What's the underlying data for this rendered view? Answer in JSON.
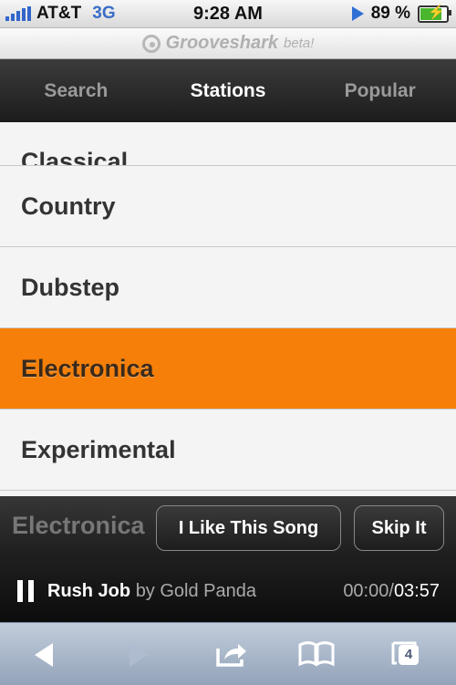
{
  "status_bar": {
    "carrier": "AT&T",
    "network": "3G",
    "time": "9:28 AM",
    "battery_percent": "89 %",
    "battery_level": 0.89
  },
  "browser": {
    "site_name": "Grooveshark",
    "site_tag": "beta!",
    "open_tabs": "4"
  },
  "nav": {
    "tabs": [
      {
        "label": "Search"
      },
      {
        "label": "Stations"
      },
      {
        "label": "Popular"
      }
    ],
    "active_tab": "Stations"
  },
  "stations": {
    "items": [
      {
        "label": "Classical"
      },
      {
        "label": "Country"
      },
      {
        "label": "Dubstep"
      },
      {
        "label": "Electronica"
      },
      {
        "label": "Experimental"
      }
    ],
    "selected": "Electronica"
  },
  "now_playing": {
    "station": "Electronica",
    "like_label": "I Like This Song",
    "skip_label": "Skip It",
    "song": "Rush Job",
    "by": "by",
    "artist": "Gold Panda",
    "elapsed": "00:00",
    "separator": "/",
    "duration": "03:57"
  },
  "colors": {
    "accent": "#f57f08",
    "signal": "#3366cc",
    "network": "#3a6ec8"
  }
}
